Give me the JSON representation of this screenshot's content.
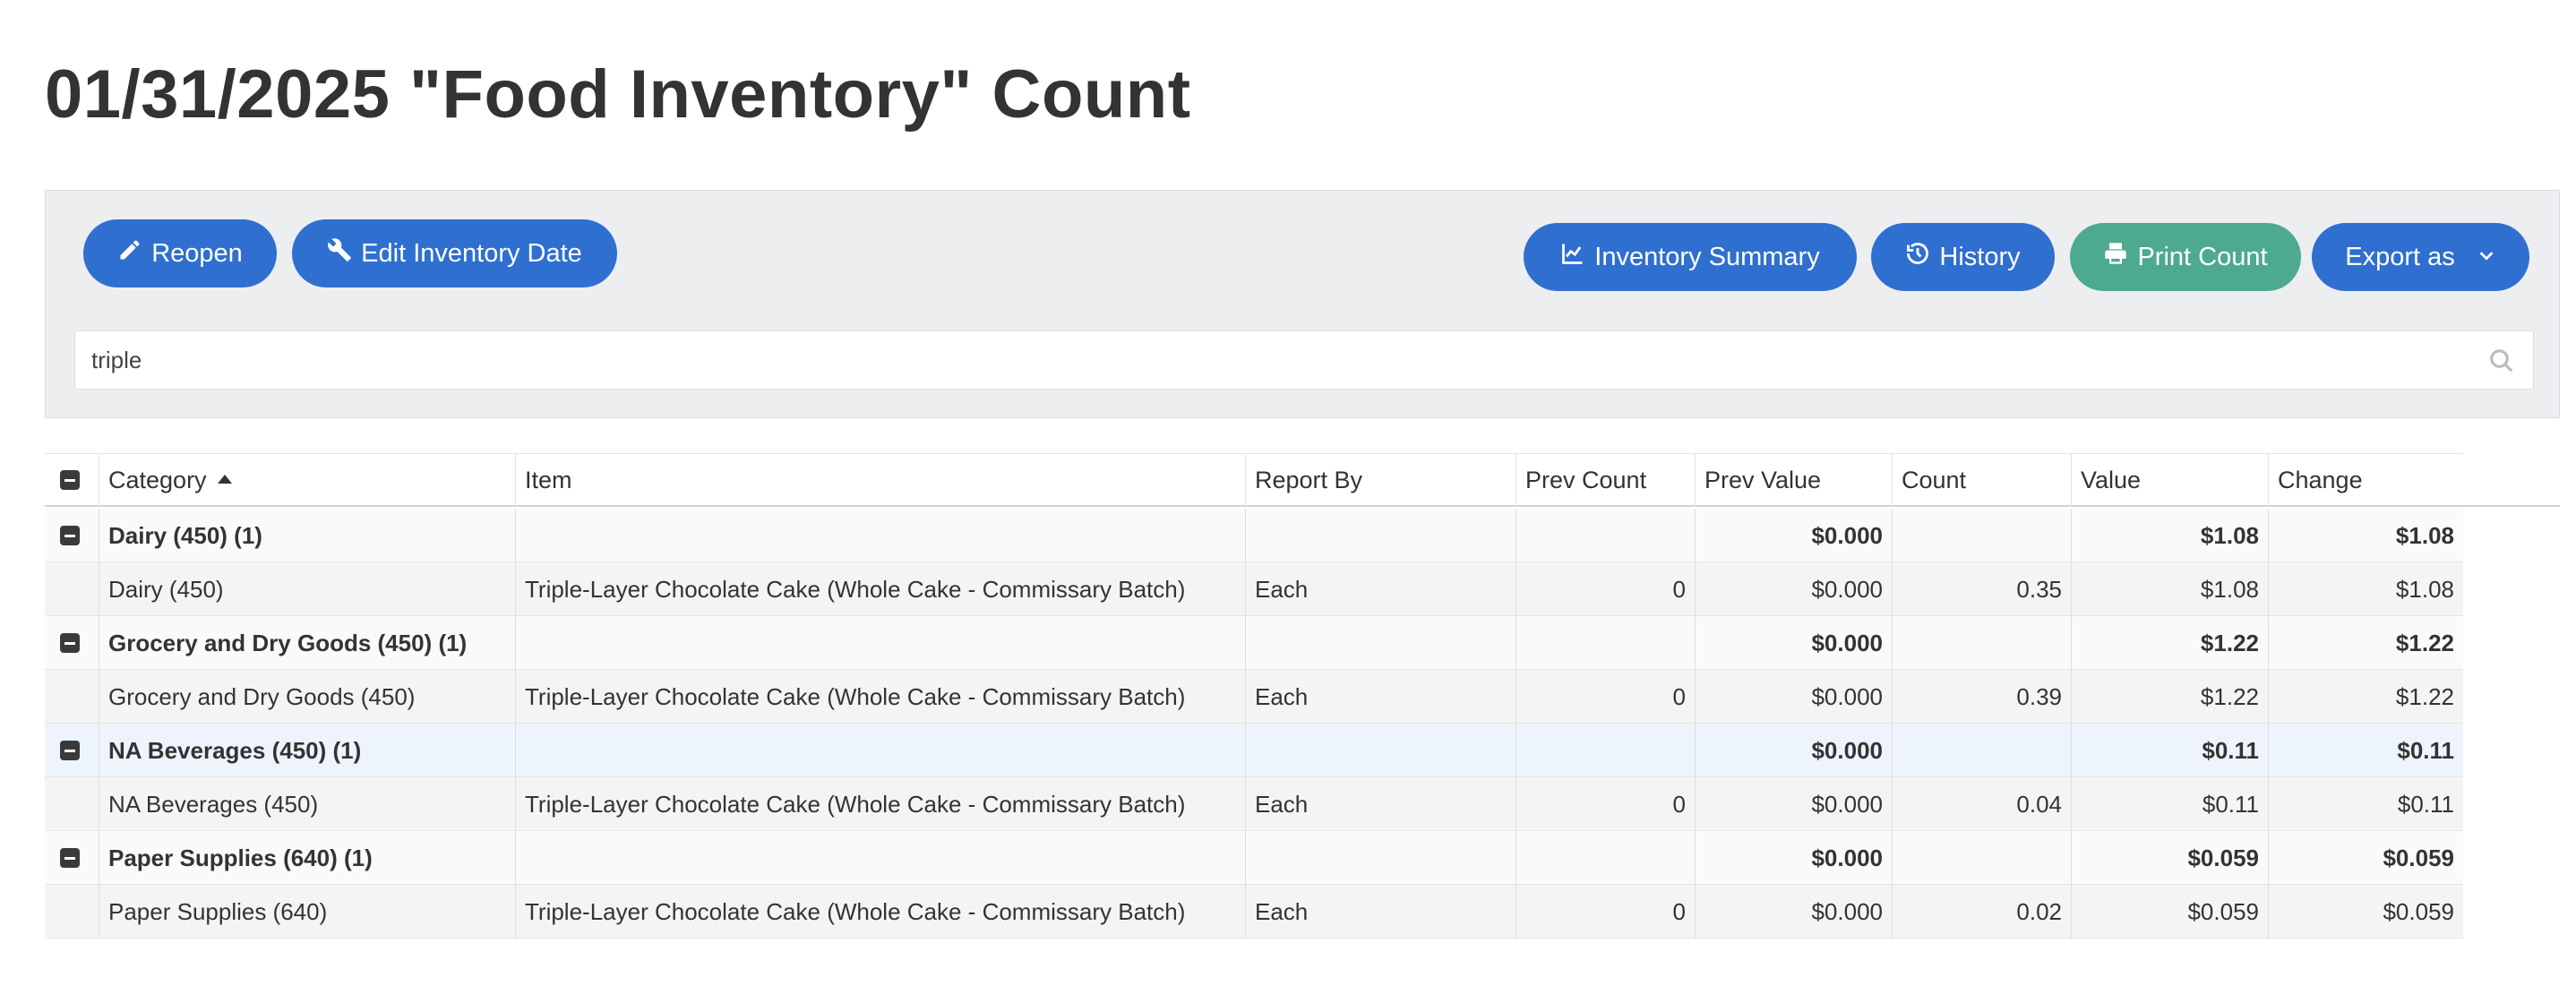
{
  "page": {
    "title": "01/31/2025 \"Food Inventory\" Count"
  },
  "toolbar": {
    "reopen_label": "Reopen",
    "edit_date_label": "Edit Inventory Date",
    "summary_label": "Inventory Summary",
    "history_label": "History",
    "print_label": "Print Count",
    "export_label": "Export as"
  },
  "search": {
    "value": "triple"
  },
  "columns": {
    "category": "Category",
    "item": "Item",
    "report_by": "Report By",
    "prev_count": "Prev Count",
    "prev_value": "Prev Value",
    "count": "Count",
    "value": "Value",
    "change": "Change"
  },
  "groups": [
    {
      "label": "Dairy (450) (1)",
      "prev_value": "$0.000",
      "value": "$1.08",
      "change": "$1.08",
      "row": {
        "category": "Dairy (450)",
        "item": "Triple-Layer Chocolate Cake (Whole Cake - Commissary Batch)",
        "report_by": "Each",
        "prev_count": "0",
        "prev_value": "$0.000",
        "count": "0.35",
        "value": "$1.08",
        "change": "$1.08"
      }
    },
    {
      "label": "Grocery and Dry Goods (450) (1)",
      "prev_value": "$0.000",
      "value": "$1.22",
      "change": "$1.22",
      "row": {
        "category": "Grocery and Dry Goods (450)",
        "item": "Triple-Layer Chocolate Cake (Whole Cake - Commissary Batch)",
        "report_by": "Each",
        "prev_count": "0",
        "prev_value": "$0.000",
        "count": "0.39",
        "value": "$1.22",
        "change": "$1.22"
      }
    },
    {
      "label": "NA Beverages (450) (1)",
      "prev_value": "$0.000",
      "value": "$0.11",
      "change": "$0.11",
      "row": {
        "category": "NA Beverages (450)",
        "item": "Triple-Layer Chocolate Cake (Whole Cake - Commissary Batch)",
        "report_by": "Each",
        "prev_count": "0",
        "prev_value": "$0.000",
        "count": "0.04",
        "value": "$0.11",
        "change": "$0.11"
      }
    },
    {
      "label": "Paper Supplies (640) (1)",
      "prev_value": "$0.000",
      "value": "$0.059",
      "change": "$0.059",
      "row": {
        "category": "Paper Supplies (640)",
        "item": "Triple-Layer Chocolate Cake (Whole Cake - Commissary Batch)",
        "report_by": "Each",
        "prev_count": "0",
        "prev_value": "$0.000",
        "count": "0.02",
        "value": "$0.059",
        "change": "$0.059"
      }
    }
  ]
}
